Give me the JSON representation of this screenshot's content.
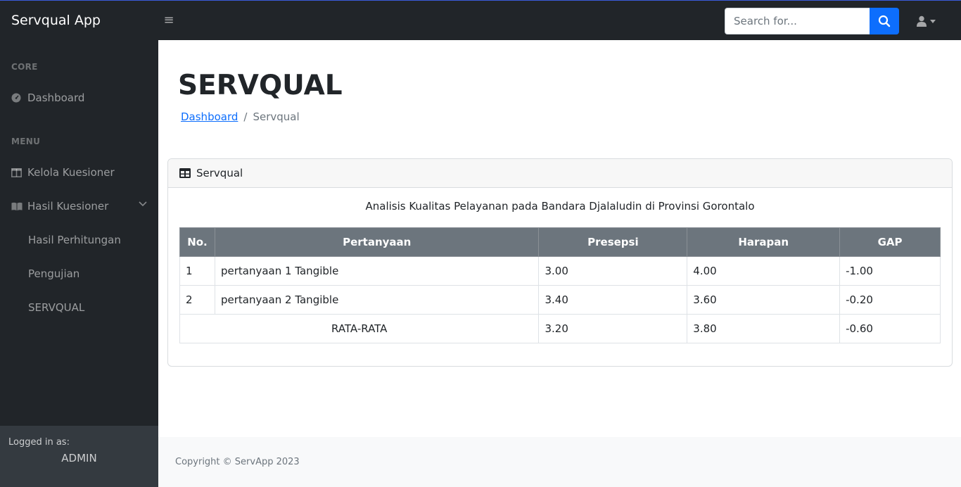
{
  "app": {
    "brand": "Servqual App"
  },
  "topbar": {
    "search_placeholder": "Search for..."
  },
  "sidebar": {
    "heading_core": "CORE",
    "dashboard": "Dashboard",
    "heading_menu": "MENU",
    "kelola": "Kelola Kuesioner",
    "hasil": "Hasil Kuesioner",
    "sub_items": [
      "Hasil Perhitungan",
      "Pengujian",
      "SERVQUAL"
    ],
    "logged_label": "Logged in as:",
    "user": "ADMIN"
  },
  "page": {
    "title": "SERVQUAL",
    "breadcrumb_link": "Dashboard",
    "breadcrumb_sep": "/",
    "breadcrumb_current": "Servqual"
  },
  "card": {
    "header": "Servqual",
    "caption": "Analisis Kualitas Pelayanan pada Bandara Djalaludin di Provinsi Gorontalo",
    "columns": [
      "No.",
      "Pertanyaan",
      "Presepsi",
      "Harapan",
      "GAP"
    ],
    "rows": [
      {
        "no": "1",
        "pertanyaan": "pertanyaan 1 Tangible",
        "presepsi": "3.00",
        "harapan": "4.00",
        "gap": "-1.00"
      },
      {
        "no": "2",
        "pertanyaan": "pertanyaan 2 Tangible",
        "presepsi": "3.40",
        "harapan": "3.60",
        "gap": "-0.20"
      }
    ],
    "summary": {
      "label": "RATA-RATA",
      "presepsi": "3.20",
      "harapan": "3.80",
      "gap": "-0.60"
    }
  },
  "footer": {
    "copyright": "Copyright © ServApp 2023"
  },
  "colors": {
    "primary": "#0d6efd",
    "dark": "#212529",
    "table_header": "#6c757d"
  }
}
